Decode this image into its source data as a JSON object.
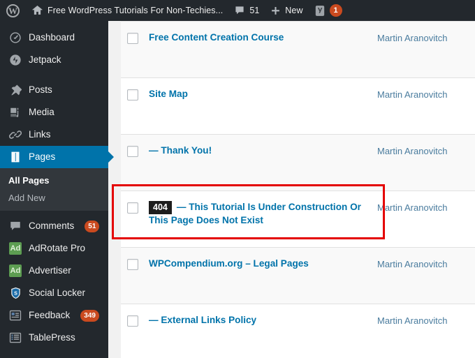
{
  "adminbar": {
    "wp_logo": "wordpress-logo",
    "home_icon": "home-icon",
    "site_title": "Free WordPress Tutorials For Non-Techies...",
    "comments_icon": "comment-bubble-icon",
    "comments_count": "51",
    "new_icon": "plus-icon",
    "new_label": "New",
    "yoast_icon": "yoast-seo-icon",
    "yoast_badge": "1"
  },
  "sidebar": {
    "items": [
      {
        "label": "Dashboard",
        "icon": "dashboard-icon",
        "badge": null,
        "current": false
      },
      {
        "label": "Jetpack",
        "icon": "jetpack-icon",
        "badge": null,
        "current": false
      },
      {
        "label": "Posts",
        "icon": "pin-icon",
        "badge": null,
        "current": false
      },
      {
        "label": "Media",
        "icon": "media-icon",
        "badge": null,
        "current": false
      },
      {
        "label": "Links",
        "icon": "link-icon",
        "badge": null,
        "current": false
      },
      {
        "label": "Pages",
        "icon": "pages-icon",
        "badge": null,
        "current": true
      },
      {
        "label": "Comments",
        "icon": "comment-bubble-icon",
        "badge": "51",
        "current": false
      },
      {
        "label": "AdRotate Pro",
        "icon": "ad-icon",
        "badge": null,
        "current": false
      },
      {
        "label": "Advertiser",
        "icon": "ad-icon",
        "badge": null,
        "current": false
      },
      {
        "label": "Social Locker",
        "icon": "shield-icon",
        "badge": null,
        "current": false
      },
      {
        "label": "Feedback",
        "icon": "feedback-icon",
        "badge": "349",
        "current": false
      },
      {
        "label": "TablePress",
        "icon": "table-icon",
        "badge": null,
        "current": false
      }
    ],
    "submenu": [
      {
        "label": "All Pages",
        "current": true
      },
      {
        "label": "Add New",
        "current": false
      }
    ]
  },
  "pages_table": {
    "rows": [
      {
        "checkbox": "unchecked",
        "status_badge": null,
        "title": "Free Content Creation Course",
        "author": "Martin Aranovitch",
        "alt": true,
        "highlighted": false
      },
      {
        "checkbox": "unchecked",
        "status_badge": null,
        "title": "Site Map",
        "author": "Martin Aranovitch",
        "alt": false,
        "highlighted": false
      },
      {
        "checkbox": "unchecked",
        "status_badge": null,
        "title": "— Thank You!",
        "author": "Martin Aranovitch",
        "alt": true,
        "highlighted": false
      },
      {
        "checkbox": "unchecked",
        "status_badge": "404",
        "title": "— This Tutorial Is Under Construction Or This Page Does Not Exist",
        "author": "Martin Aranovitch",
        "alt": false,
        "highlighted": true
      },
      {
        "checkbox": "unchecked",
        "status_badge": null,
        "title": "WPCompendium.org – Legal Pages",
        "author": "Martin Aranovitch",
        "alt": true,
        "highlighted": false
      },
      {
        "checkbox": "unchecked",
        "status_badge": null,
        "title": "— External Links Policy",
        "author": "Martin Aranovitch",
        "alt": false,
        "highlighted": false
      }
    ]
  },
  "annotation": {
    "highlight_color": "#e40000",
    "highlight_target": "404 page row"
  },
  "colors": {
    "admin_dark": "#23282d",
    "submenu_dark": "#32373c",
    "accent_blue": "#0073aa",
    "link_blue": "#0073aa",
    "badge_orange": "#ca4a1f",
    "highlight_red": "#e40000"
  }
}
